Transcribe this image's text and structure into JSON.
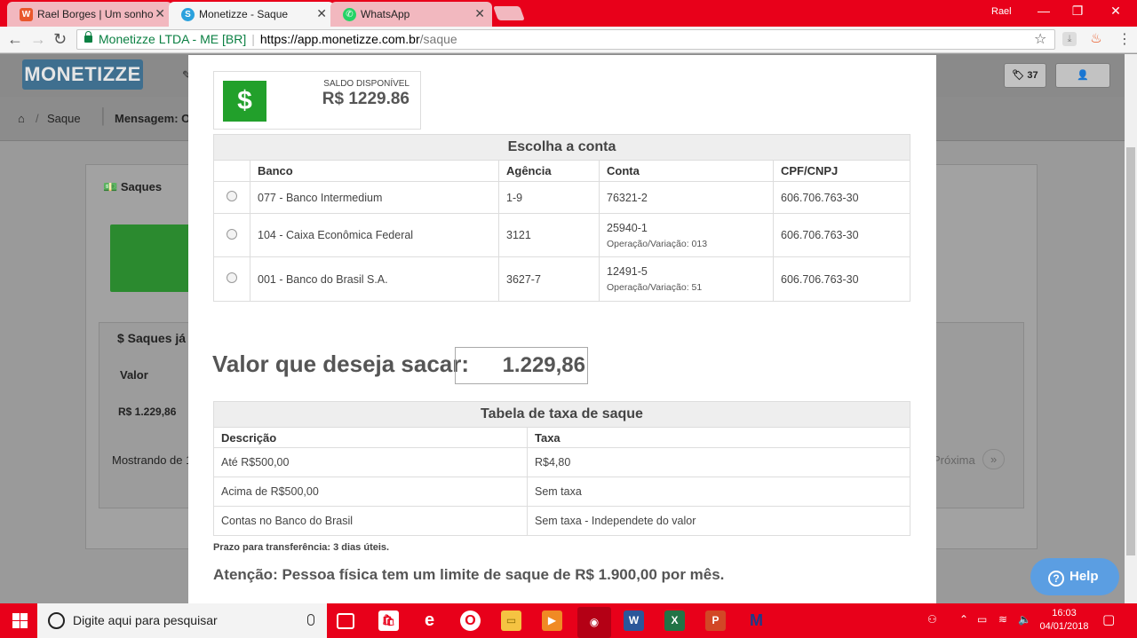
{
  "browser": {
    "tabs": [
      {
        "label": "Rael Borges | Um sonho",
        "icon": "w-icon",
        "color": "#e9572b"
      },
      {
        "label": "Monetizze - Saque",
        "icon": "monetizze-icon",
        "color": "#2aa1dd"
      },
      {
        "label": "WhatsApp",
        "icon": "whatsapp-icon",
        "color": "#25d366"
      }
    ],
    "user": "Rael",
    "secure_label": "Monetizze LTDA - ME [BR]",
    "url_host": "https://app.monetizze.com.br",
    "url_path": "/saque"
  },
  "site": {
    "logo": "MONETIZZE",
    "tag_count": "37",
    "breadcrumb_page": "Saque",
    "breadcrumb_message": "Mensagem: O",
    "panel_title": "Saques",
    "history_title": "$ Saques já",
    "history_col": "Valor",
    "history_value": "R$ 1.229,86",
    "showing": "Mostrando de 1",
    "next": "Próxima",
    "last": "»"
  },
  "modal": {
    "balance_label": "SALDO DISPONÍVEL",
    "balance_value": "R$ 1229.86",
    "accounts_title": "Escolha a conta",
    "accounts_headers": [
      "Banco",
      "Agência",
      "Conta",
      "CPF/CNPJ"
    ],
    "accounts": [
      {
        "bank": "077 - Banco Intermedium",
        "agency": "1-9",
        "account": "76321-2",
        "operation": "",
        "doc": "606.706.763-30"
      },
      {
        "bank": "104 - Caixa Econômica Federal",
        "agency": "3121",
        "account": "25940-1",
        "operation": "Operação/Variação: 013",
        "doc": "606.706.763-30"
      },
      {
        "bank": "001 - Banco do Brasil S.A.",
        "agency": "3627-7",
        "account": "12491-5",
        "operation": "Operação/Variação: 51",
        "doc": "606.706.763-30"
      }
    ],
    "amount_label": "Valor que deseja sacar:",
    "amount_value": "1.229,86",
    "fees_title": "Tabela de taxa de saque",
    "fees_headers": [
      "Descrição",
      "Taxa"
    ],
    "fees": [
      {
        "desc": "Até R$500,00",
        "fee": "R$4,80"
      },
      {
        "desc": "Acima de R$500,00",
        "fee": "Sem taxa"
      },
      {
        "desc": "Contas no Banco do Brasil",
        "fee": "Sem taxa - Independete do valor"
      }
    ],
    "deadline": "Prazo para transferência: 3 dias úteis.",
    "warning": "Atenção: Pessoa física tem um limite de saque de R$ 1.900,00 por mês."
  },
  "help": {
    "label": "Help"
  },
  "taskbar": {
    "search_placeholder": "Digite aqui para pesquisar",
    "time": "16:03",
    "date": "04/01/2018"
  }
}
